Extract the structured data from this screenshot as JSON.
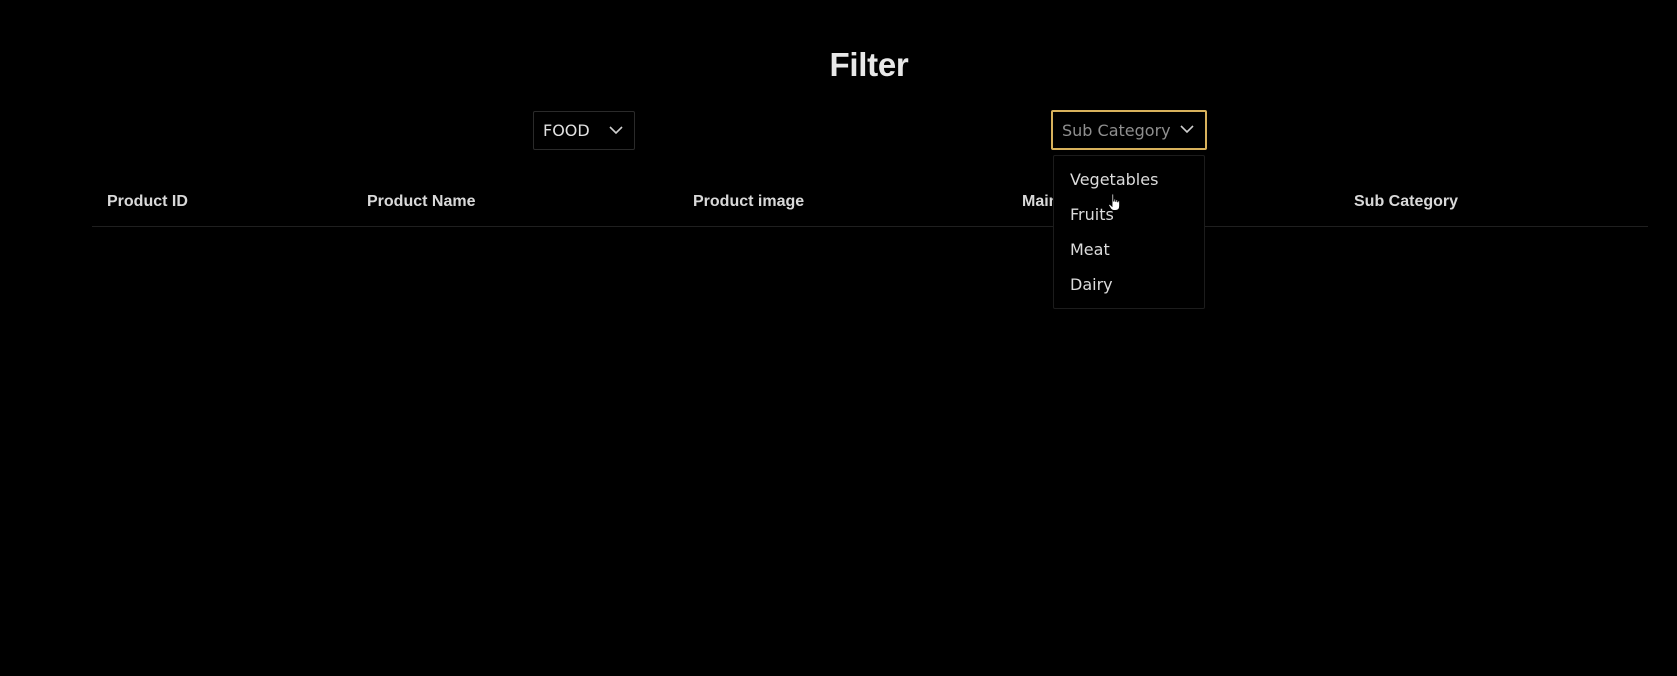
{
  "page": {
    "title": "Filter"
  },
  "filters": {
    "main_category": {
      "selected": "FOOD",
      "icon": "chevron-down-icon"
    },
    "sub_category": {
      "placeholder": "Sub Category",
      "icon": "chevron-down-icon",
      "accent_color": "#d8b25c",
      "options": [
        "Vegetables",
        "Fruits",
        "Meat",
        "Dairy"
      ]
    }
  },
  "table": {
    "columns": [
      "Product ID",
      "Product Name",
      "Product image",
      "Main Category",
      "Sub Category"
    ],
    "rows": []
  },
  "colors": {
    "background": "#000000",
    "text": "#e6e6e6",
    "focus_border": "#d8b25c"
  }
}
